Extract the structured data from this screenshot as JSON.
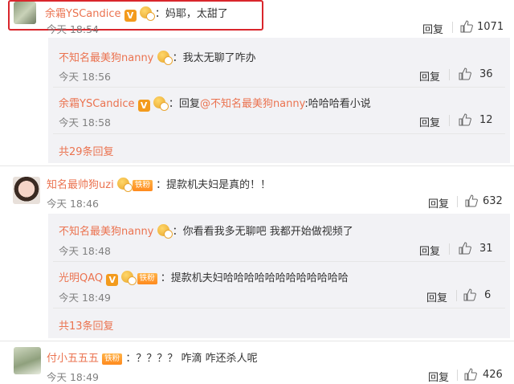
{
  "comments": [
    {
      "user": "余霜YSCandice",
      "text": "：妈耶，太甜了",
      "time": "今天 18:54",
      "reply_label": "回复",
      "likes": "1071",
      "replies": [
        {
          "user": "不知名最美狗nanny",
          "text": "：我太无聊了咋办",
          "time": "今天 18:56",
          "reply_label": "回复",
          "likes": "36"
        },
        {
          "user": "余霜YSCandice",
          "text": "：回复",
          "mention": "@不知名最美狗nanny",
          "text2": ":哈哈哈看小说",
          "time": "今天 18:58",
          "reply_label": "回复",
          "likes": "12"
        }
      ],
      "more": "共29条回复"
    },
    {
      "user": "知名最帅狗uzi",
      "badge": "铁粉",
      "text": "：提款机夫妇是真的！！",
      "time": "今天 18:46",
      "reply_label": "回复",
      "likes": "632",
      "replies": [
        {
          "user": "不知名最美狗nanny",
          "text": "：你看看我多无聊吧 我都开始做视频了",
          "time": "今天 18:48",
          "reply_label": "回复",
          "likes": "31"
        },
        {
          "user": "光明QAQ",
          "badge": "铁粉",
          "text": "：提款机夫妇哈哈哈哈哈哈哈哈哈哈哈哈",
          "time": "今天 18:49",
          "reply_label": "回复",
          "likes": "6"
        }
      ],
      "more": "共13条回复"
    },
    {
      "user": "付小五五五",
      "badge": "铁粉",
      "text": "：？？？？ 咋滴 咋还杀人呢",
      "time": "今天 18:49",
      "reply_label": "回复",
      "likes": "426"
    }
  ],
  "icons": {
    "like": "thumbs-up-icon",
    "vip": "vip-v-icon",
    "level": "gold-medal-icon"
  },
  "colors": {
    "username": "#eb7350",
    "highlight_border": "#d9262c",
    "reply_panel": "#f2f2f5",
    "time": "#808080"
  },
  "vip_letter": "V"
}
